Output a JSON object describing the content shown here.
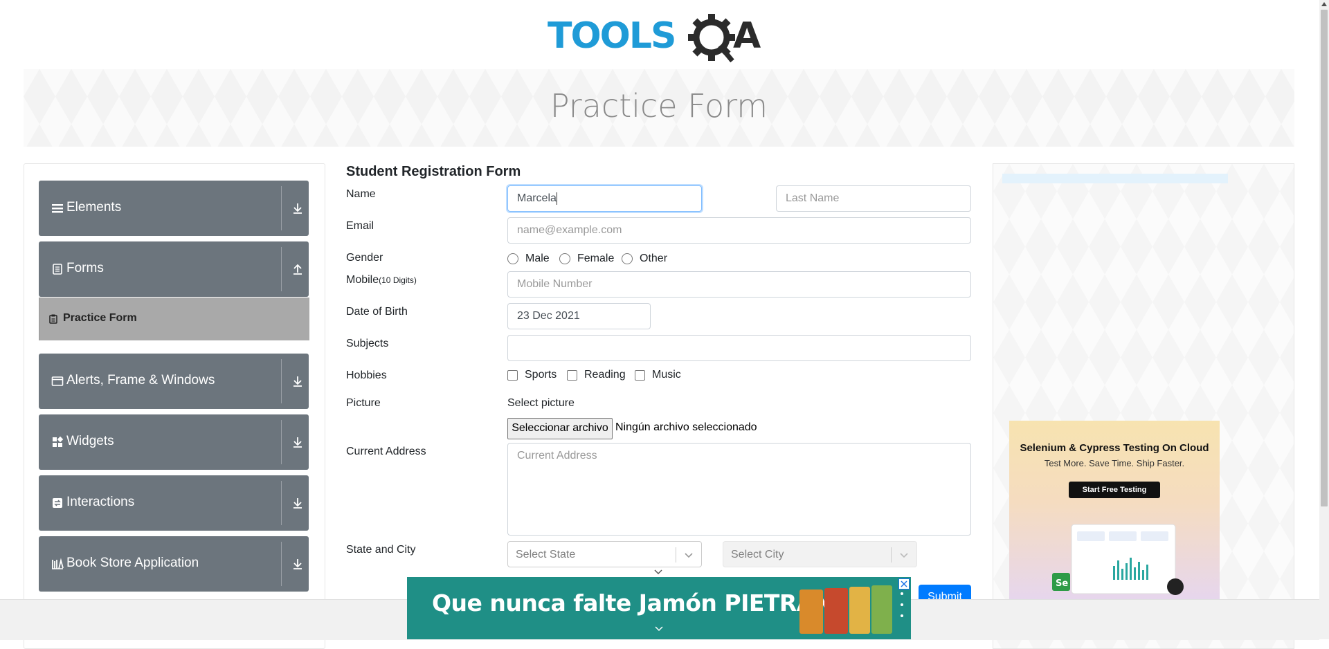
{
  "logo": {
    "text": "TOOLSQA",
    "brand_color": "#1f9bd7",
    "dark_color": "#2b2b2b"
  },
  "banner": {
    "title": "Practice Form"
  },
  "sidebar": {
    "groups": [
      {
        "label": "Elements",
        "icon": "hamburger-icon",
        "state": "collapsed"
      },
      {
        "label": "Forms",
        "icon": "document-icon",
        "state": "expanded"
      },
      {
        "label": "Alerts, Frame & Windows",
        "icon": "window-icon",
        "state": "collapsed"
      },
      {
        "label": "Widgets",
        "icon": "widgets-icon",
        "state": "collapsed"
      },
      {
        "label": "Interactions",
        "icon": "interactions-icon",
        "state": "collapsed"
      },
      {
        "label": "Book Store Application",
        "icon": "book-icon",
        "state": "collapsed"
      }
    ],
    "subitems": [
      {
        "label": "Practice Form",
        "icon": "clipboard-icon",
        "active": true
      }
    ]
  },
  "form": {
    "title": "Student Registration Form",
    "name_label": "Name",
    "first_name_value": "Marcela",
    "last_name_placeholder": "Last Name",
    "email_label": "Email",
    "email_placeholder": "name@example.com",
    "gender_label": "Gender",
    "gender_options": [
      "Male",
      "Female",
      "Other"
    ],
    "mobile_label": "Mobile",
    "mobile_hint": "(10 Digits)",
    "mobile_placeholder": "Mobile Number",
    "dob_label": "Date of Birth",
    "dob_value": "23 Dec 2021",
    "subjects_label": "Subjects",
    "hobbies_label": "Hobbies",
    "hobbies_options": [
      "Sports",
      "Reading",
      "Music"
    ],
    "picture_label": "Picture",
    "picture_prompt": "Select picture",
    "file_button": "Seleccionar archivo",
    "file_status": "Ningún archivo seleccionado",
    "address_label": "Current Address",
    "address_placeholder": "Current Address",
    "state_city_label": "State and City",
    "state_placeholder": "Select State",
    "city_placeholder": "Select City",
    "submit_label": "Submit"
  },
  "promo": {
    "title": "Selenium & Cypress Testing On Cloud",
    "subtitle": "Test More. Save Time. Ship Faster.",
    "button": "Start Free Testing"
  },
  "bottom_ad": {
    "text": "Que nunca falte Jamón PIETRÁN",
    "bg_color": "#1f8f86"
  },
  "colors": {
    "sidebar_group_bg": "#6c757d",
    "active_subitem_bg": "#a9a9a9",
    "primary": "#007bff",
    "focus_border": "#80bdff"
  }
}
